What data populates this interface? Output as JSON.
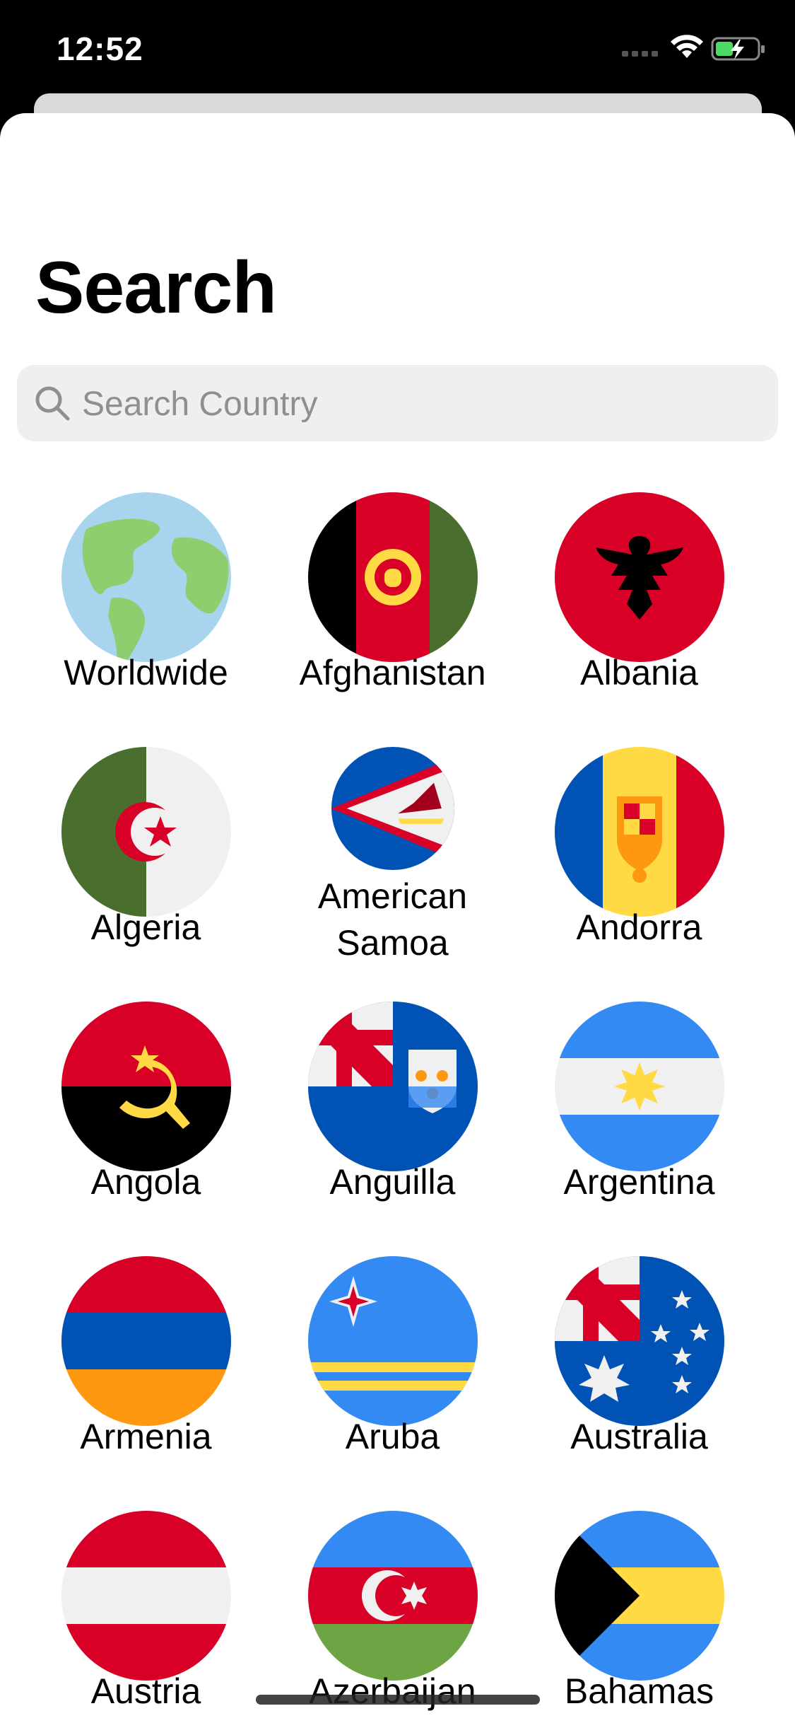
{
  "status_bar": {
    "time": "12:52"
  },
  "page": {
    "title": "Search"
  },
  "search": {
    "placeholder": "Search Country",
    "value": ""
  },
  "countries": [
    {
      "name": "Worldwide",
      "flag": "globe-icon"
    },
    {
      "name": "Afghanistan",
      "flag": "afghanistan-flag-icon"
    },
    {
      "name": "Albania",
      "flag": "albania-flag-icon"
    },
    {
      "name": "Algeria",
      "flag": "algeria-flag-icon"
    },
    {
      "name": "American Samoa",
      "flag": "american-samoa-flag-icon"
    },
    {
      "name": "Andorra",
      "flag": "andorra-flag-icon"
    },
    {
      "name": "Angola",
      "flag": "angola-flag-icon"
    },
    {
      "name": "Anguilla",
      "flag": "anguilla-flag-icon"
    },
    {
      "name": "Argentina",
      "flag": "argentina-flag-icon"
    },
    {
      "name": "Armenia",
      "flag": "armenia-flag-icon"
    },
    {
      "name": "Aruba",
      "flag": "aruba-flag-icon"
    },
    {
      "name": "Australia",
      "flag": "australia-flag-icon"
    },
    {
      "name": "Austria",
      "flag": "austria-flag-icon"
    },
    {
      "name": "Azerbaijan",
      "flag": "azerbaijan-flag-icon"
    },
    {
      "name": "Bahamas",
      "flag": "bahamas-flag-icon"
    }
  ]
}
